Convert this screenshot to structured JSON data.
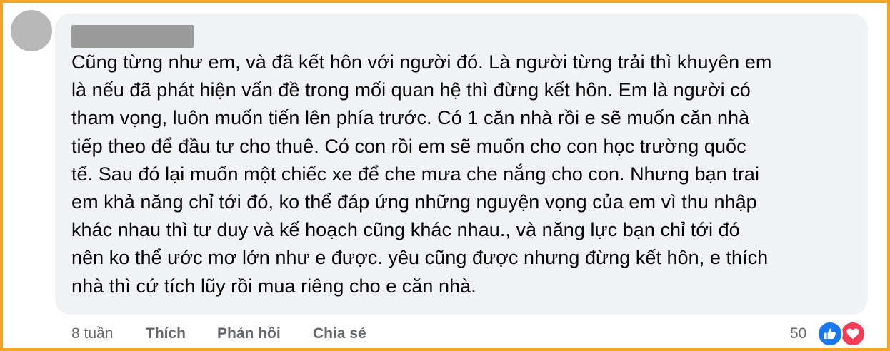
{
  "comment": {
    "lines": [
      "Cũng từng như em, và đã kết hôn với người đó. Là người từng trải thì khuyên em",
      "là nếu đã phát hiện vấn đề trong mối quan hệ thì đừng kết hôn. Em là người có",
      "tham vọng, luôn muốn tiến lên phía trước. Có 1 căn nhà rồi e sẽ muốn căn nhà",
      "tiếp theo để đầu tư cho thuê. Có con rồi em sẽ muốn cho con học trường quốc",
      "tế. Sau đó lại muốn một chiếc xe để che mưa che nắng cho con. Nhưng bạn trai",
      "em khả năng chỉ tới đó, ko thể đáp ứng những nguyện vọng của em vì thu nhập",
      "khác nhau thì tư duy và kế hoạch cũng khác nhau., và năng lực bạn chỉ tới đó",
      "nên ko thể ước mơ lớn như e được. yêu cũng được nhưng đừng kết hôn, e thích",
      "nhà thì cứ tích lũy rồi mua riêng cho e căn nhà."
    ]
  },
  "actions": {
    "time": "8 tuần",
    "like_label": "Thích",
    "reply_label": "Phản hồi",
    "share_label": "Chia sẻ"
  },
  "reactions": {
    "count": "50",
    "icons": [
      "like-icon",
      "love-icon"
    ]
  },
  "colors": {
    "frame_border": "#f4a522",
    "bubble_bg": "#f0f2f5",
    "text": "#050505",
    "meta_text": "#65676b",
    "like_blue": "#1877f2",
    "love_red": "#f33e58"
  }
}
